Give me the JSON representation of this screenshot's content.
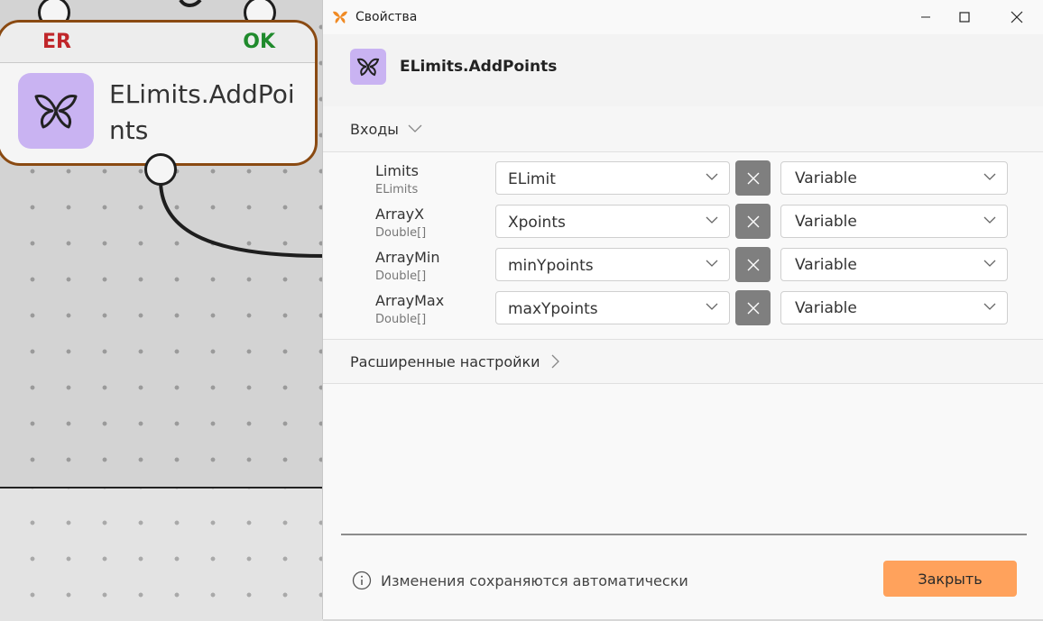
{
  "node": {
    "error_label": "ER",
    "ok_label": "OK",
    "title": "ELimits.AddPoints",
    "icon": "butterfly-icon",
    "border_color": "#8a4a12",
    "icon_bg": "#c9b3f2"
  },
  "dialog": {
    "window_title": "Свойства",
    "app_icon": "butterfly-icon",
    "header_title": "ELimits.AddPoints",
    "inputs_section_label": "Входы",
    "advanced_section_label": "Расширенные настройки",
    "params": [
      {
        "name": "Limits",
        "type": "ELimits",
        "value": "ELimit",
        "mode": "Variable"
      },
      {
        "name": "ArrayX",
        "type": "Double[]",
        "value": "Xpoints",
        "mode": "Variable"
      },
      {
        "name": "ArrayMin",
        "type": "Double[]",
        "value": "minYpoints",
        "mode": "Variable"
      },
      {
        "name": "ArrayMax",
        "type": "Double[]",
        "value": "maxYpoints",
        "mode": "Variable"
      }
    ],
    "footer_info": "Изменения сохраняются автоматически",
    "close_button": "Закрыть",
    "accent_color": "#ffa25c"
  }
}
